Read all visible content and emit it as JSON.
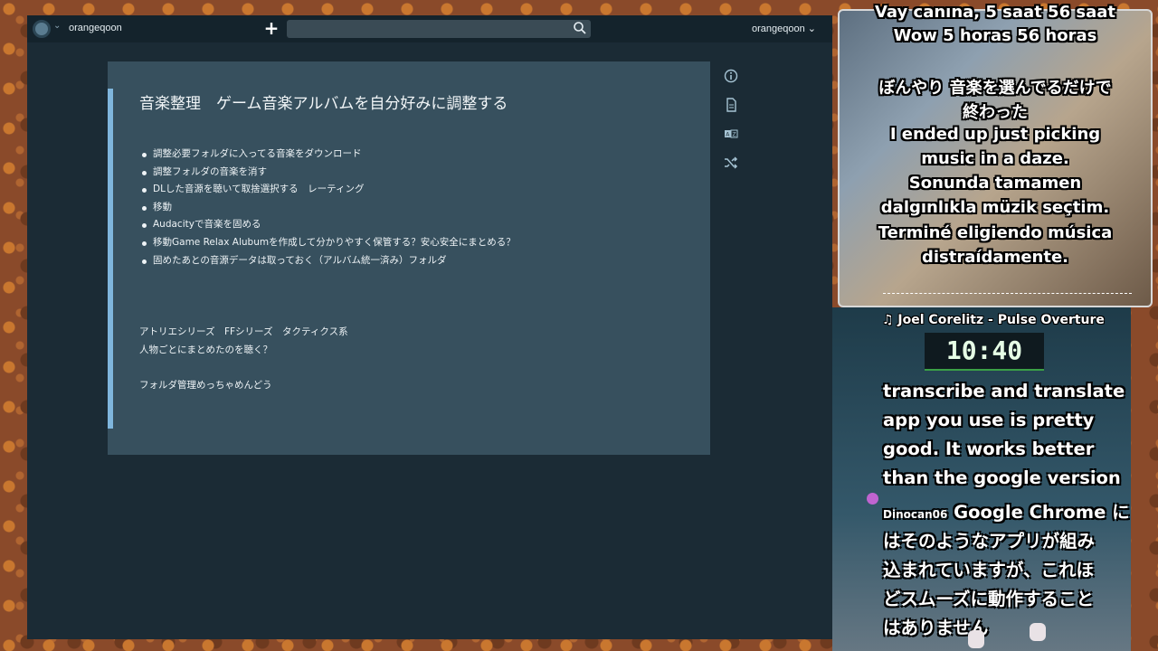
{
  "app": {
    "brand": "orangeqoon",
    "user_menu": "orangeqoon ⌄",
    "search": {
      "placeholder": "",
      "value": ""
    },
    "new_button": "+"
  },
  "document": {
    "title": "音楽整理　ゲーム音楽アルバムを自分好みに調整する",
    "bullets": [
      "調整必要フォルダに入ってる音楽をダウンロード",
      "調整フォルダの音楽を消す",
      "DLした音源を聴いて取捨選択する　レーティング",
      "移動",
      "Audacityで音楽を固める",
      "移動Game Relax Alubumを作成して分かりやすく保管する？安心安全にまとめる？",
      "固めたあとの音源データは取っておく（アルバム統一済み）フォルダ"
    ],
    "paragraphs": [
      "アトリエシリーズ　FFシリーズ　タクティクス系",
      "人物ごとにまとめたのを聴く？",
      "フォルダ管理めっちゃめんどう"
    ]
  },
  "side_tools": [
    "info-icon",
    "document-icon",
    "translate-icon",
    "shuffle-icon"
  ],
  "stream": {
    "captions": [
      "Vay canına, 5 saat 56 saat",
      "Wow 5 horas 56 horas",
      "ぼんやり 音楽を選んでるだけで",
      "終わった",
      "I ended up just picking",
      "music in a daze.",
      "Sonunda tamamen",
      "dalgınlıkla müzik seçtim.",
      "Terminé eligiendo música",
      "distraídamente."
    ],
    "now_playing": "♫ Joel Corelitz - Pulse Overture",
    "timer": "10:40",
    "chat_lines": [
      "transcribe and translate",
      "app you use is pretty",
      "good. It works better",
      "than the google version"
    ],
    "chat_user": "Dinocan06",
    "chat_message_first": "Google Chrome に",
    "chat_message_lines": [
      "はそのようなアプリが組み",
      "込まれていますが、これほ",
      "どスムーズに動作すること",
      "はありません"
    ]
  }
}
